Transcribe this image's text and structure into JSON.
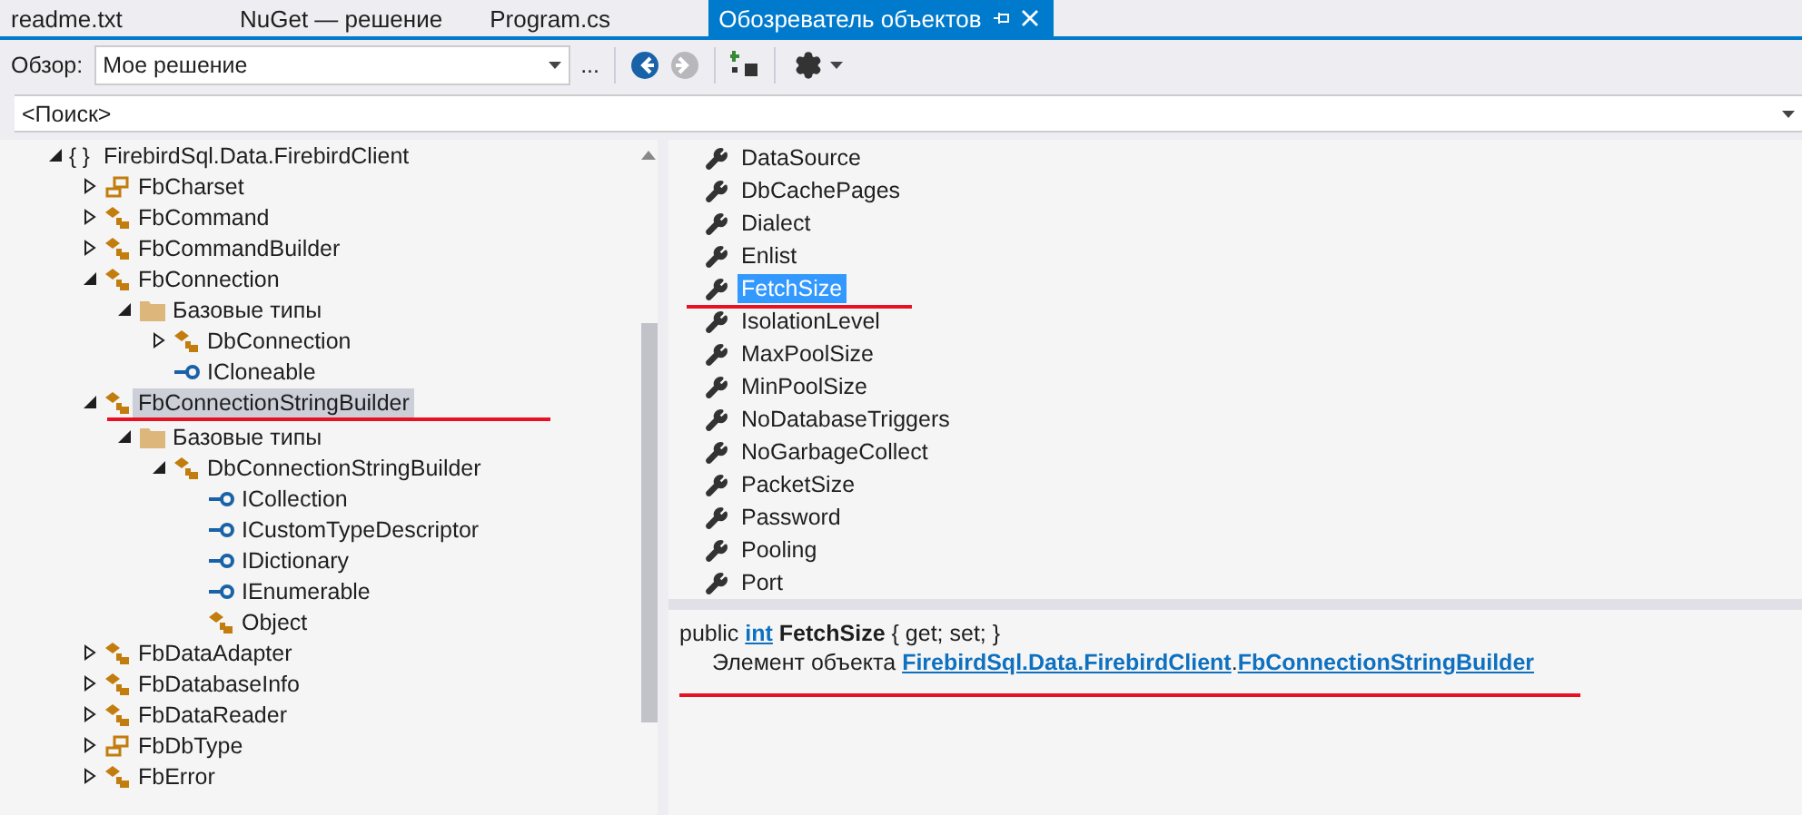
{
  "tabs": [
    {
      "label": "readme.txt",
      "selected": false
    },
    {
      "label": "NuGet — решение",
      "selected": false
    },
    {
      "label": "Program.cs",
      "selected": false
    },
    {
      "label": "Обозреватель объектов",
      "selected": true
    }
  ],
  "toolbar": {
    "browse_label": "Обзор:",
    "browse_value": "Мое решение",
    "more_button": "...",
    "nav": [
      {
        "kind": "back",
        "disabled": false
      },
      {
        "kind": "forward",
        "disabled": true
      }
    ]
  },
  "search": {
    "placeholder": "<Поиск>"
  },
  "tree": [
    {
      "kind": "namespace",
      "glyph": "{ }",
      "label": "FirebirdSql.Data.FirebirdClient",
      "expanded": true,
      "selected": false,
      "children": [
        {
          "kind": "enum",
          "label": "FbCharset",
          "expanded": false,
          "selected": false
        },
        {
          "kind": "class",
          "label": "FbCommand",
          "expanded": false,
          "selected": false
        },
        {
          "kind": "class",
          "label": "FbCommandBuilder",
          "expanded": false,
          "selected": false
        },
        {
          "kind": "class",
          "label": "FbConnection",
          "expanded": true,
          "selected": false,
          "children": [
            {
              "kind": "folder",
              "label": "Базовые типы",
              "expanded": true,
              "selected": false,
              "children": [
                {
                  "kind": "class",
                  "label": "DbConnection",
                  "expanded": false,
                  "selected": false
                },
                {
                  "kind": "interface",
                  "label": "ICloneable",
                  "selected": false
                }
              ]
            }
          ]
        },
        {
          "kind": "class",
          "label": "FbConnectionStringBuilder",
          "expanded": true,
          "selected": true,
          "children": [
            {
              "kind": "folder",
              "label": "Базовые типы",
              "expanded": true,
              "selected": false,
              "children": [
                {
                  "kind": "class",
                  "label": "DbConnectionStringBuilder",
                  "expanded": true,
                  "selected": false,
                  "children": [
                    {
                      "kind": "interface",
                      "label": "ICollection",
                      "selected": false
                    },
                    {
                      "kind": "interface",
                      "label": "ICustomTypeDescriptor",
                      "selected": false
                    },
                    {
                      "kind": "interface",
                      "label": "IDictionary",
                      "selected": false
                    },
                    {
                      "kind": "interface",
                      "label": "IEnumerable",
                      "selected": false
                    },
                    {
                      "kind": "class",
                      "label": "Object",
                      "selected": false
                    }
                  ]
                }
              ]
            }
          ]
        },
        {
          "kind": "class",
          "label": "FbDataAdapter",
          "expanded": false,
          "selected": false
        },
        {
          "kind": "class",
          "label": "FbDatabaseInfo",
          "expanded": false,
          "selected": false
        },
        {
          "kind": "class",
          "label": "FbDataReader",
          "expanded": false,
          "selected": false
        },
        {
          "kind": "enum",
          "label": "FbDbType",
          "expanded": false,
          "selected": false
        },
        {
          "kind": "class",
          "label": "FbError",
          "expanded": false,
          "selected": false
        }
      ]
    }
  ],
  "members": [
    {
      "label": "DataSource",
      "selected": false
    },
    {
      "label": "DbCachePages",
      "selected": false
    },
    {
      "label": "Dialect",
      "selected": false
    },
    {
      "label": "Enlist",
      "selected": false
    },
    {
      "label": "FetchSize",
      "selected": true
    },
    {
      "label": "IsolationLevel",
      "selected": false
    },
    {
      "label": "MaxPoolSize",
      "selected": false
    },
    {
      "label": "MinPoolSize",
      "selected": false
    },
    {
      "label": "NoDatabaseTriggers",
      "selected": false
    },
    {
      "label": "NoGarbageCollect",
      "selected": false
    },
    {
      "label": "PacketSize",
      "selected": false
    },
    {
      "label": "Password",
      "selected": false
    },
    {
      "label": "Pooling",
      "selected": false
    },
    {
      "label": "Port",
      "selected": false
    }
  ],
  "description": {
    "prefix": "public",
    "type_link": "int",
    "name": "FetchSize",
    "suffix": "{ get; set; }",
    "member_of": "Элемент объекта",
    "namespace_link": "FirebirdSql.Data.FirebirdClient",
    "separator": ".",
    "class_link": "FbConnectionStringBuilder"
  }
}
